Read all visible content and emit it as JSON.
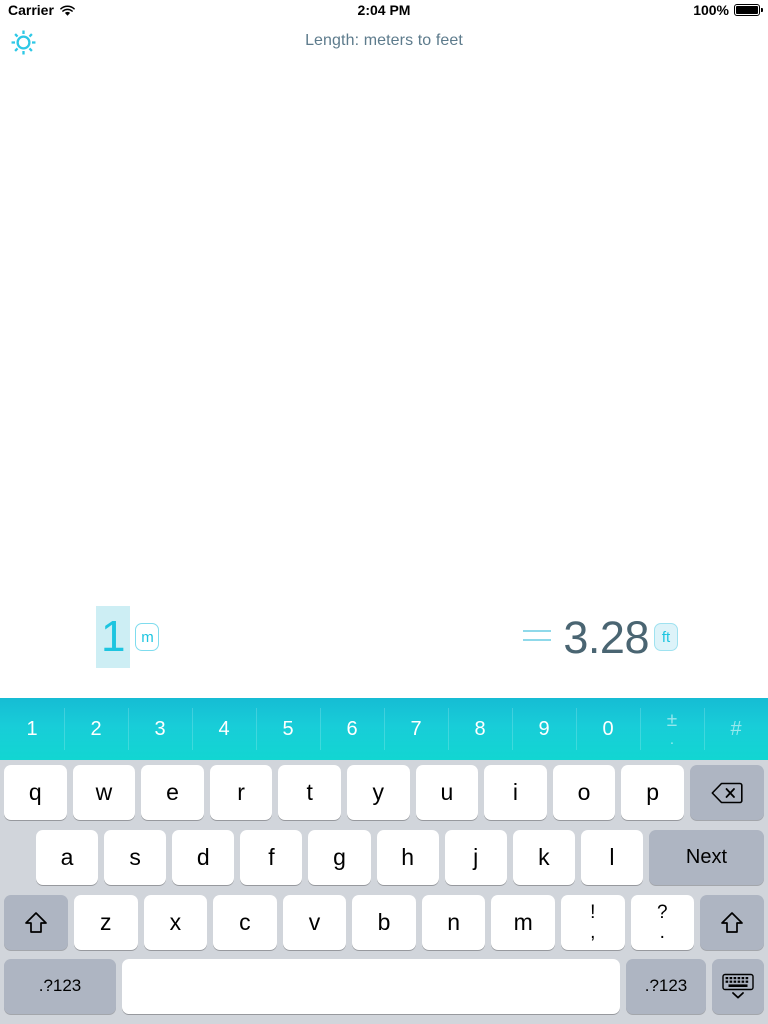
{
  "status_bar": {
    "carrier": "Carrier",
    "wifi_icon": "wifi-icon",
    "time": "2:04 PM",
    "battery_percent": "100%",
    "battery_icon": "battery-icon"
  },
  "top_bar": {
    "settings_icon": "gear-icon",
    "title": "Length: meters to feet"
  },
  "conversion": {
    "input_value": "1",
    "input_unit": "m",
    "equals_symbol": "=",
    "output_value": "3.28",
    "output_unit": "ft"
  },
  "colors": {
    "accent_cyan": "#1dc5e0",
    "numrow_gradient_top": "#16bcd4",
    "numrow_gradient_bottom": "#12d6d2",
    "selection_highlight": "#cdeef4",
    "title_text": "#5d7b8c",
    "result_text": "#4a6572",
    "keyboard_bg": "#d1d5db",
    "key_white": "#ffffff",
    "key_grey": "#aeb5c2"
  },
  "keyboard": {
    "number_row": [
      {
        "label": "1",
        "dim": false
      },
      {
        "label": "2",
        "dim": false
      },
      {
        "label": "3",
        "dim": false
      },
      {
        "label": "4",
        "dim": false
      },
      {
        "label": "5",
        "dim": false
      },
      {
        "label": "6",
        "dim": false
      },
      {
        "label": "7",
        "dim": false
      },
      {
        "label": "8",
        "dim": false
      },
      {
        "label": "9",
        "dim": false
      },
      {
        "label": "0",
        "dim": false
      }
    ],
    "number_row_extra": [
      {
        "top": "±",
        "bottom": ".",
        "name": "plusminus-decimal-key",
        "dim": true
      },
      {
        "top": "#",
        "bottom": "",
        "name": "hash-key",
        "dim": true
      }
    ],
    "row_qwerty": [
      "q",
      "w",
      "e",
      "r",
      "t",
      "y",
      "u",
      "i",
      "o",
      "p"
    ],
    "backspace_icon": "backspace-icon",
    "row_asdf": [
      "a",
      "s",
      "d",
      "f",
      "g",
      "h",
      "j",
      "k",
      "l"
    ],
    "next_label": "Next",
    "shift_icon": "shift-icon",
    "row_zxcv": [
      "z",
      "x",
      "c",
      "v",
      "b",
      "n",
      "m"
    ],
    "punctuation_keys": [
      {
        "top": "!",
        "bottom": ",",
        "name": "exclamation-comma-key"
      },
      {
        "top": "?",
        "bottom": ".",
        "name": "question-period-key"
      }
    ],
    "numsym_left_label": ".?123",
    "space_label": "",
    "numsym_right_label": ".?123",
    "hide_keyboard_icon": "hide-keyboard-icon"
  }
}
